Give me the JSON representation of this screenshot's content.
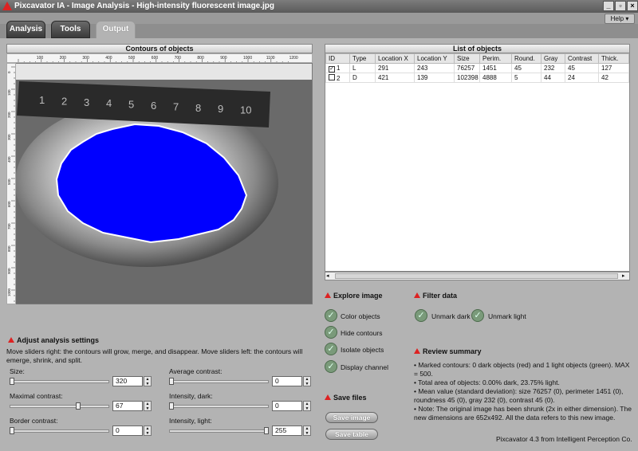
{
  "window": {
    "title": "Pixcavator IA - Image Analysis - High-intensity fluorescent image.jpg"
  },
  "menu": {
    "help_label": "Help ▾"
  },
  "tabs": [
    {
      "label": "Analysis"
    },
    {
      "label": "Tools"
    },
    {
      "label": "Output"
    }
  ],
  "left_panel": {
    "title": "Contours of objects"
  },
  "ruler": {
    "x_ticks": [
      "100",
      "200",
      "300",
      "400",
      "500",
      "600",
      "700",
      "800",
      "900",
      "1000",
      "1100",
      "1200"
    ],
    "y_ticks": [
      "0",
      "100",
      "200",
      "300",
      "400",
      "500",
      "600",
      "700",
      "800",
      "900",
      "1000"
    ]
  },
  "image": {
    "ruler_digits": [
      "1",
      "2",
      "3",
      "4",
      "5",
      "6",
      "7",
      "8",
      "9",
      "10"
    ],
    "blob_color": "#0000ff"
  },
  "list": {
    "title": "List of objects",
    "columns": [
      "ID",
      "Type",
      "Location X",
      "Location Y",
      "Size",
      "Perim.",
      "Round.",
      "Gray",
      "Contrast",
      "Thick."
    ],
    "rows": [
      {
        "checked": true,
        "cells": [
          "1",
          "L",
          "291",
          "243",
          "76257",
          "1451",
          "45",
          "232",
          "45",
          "127"
        ]
      },
      {
        "checked": false,
        "cells": [
          "2",
          "D",
          "421",
          "139",
          "102398",
          "4888",
          "5",
          "44",
          "24",
          "42"
        ]
      }
    ]
  },
  "adjust": {
    "title": "Adjust analysis settings",
    "description": "Move sliders right: the contours will grow, merge, and disappear. Move sliders left: the contours will emerge, shrink, and split.",
    "sliders": [
      {
        "label": "Size:",
        "value": "320",
        "fraction": 0.0
      },
      {
        "label": "Maximal contrast:",
        "value": "67",
        "fraction": 0.7
      },
      {
        "label": "Border contrast:",
        "value": "0",
        "fraction": 0.0
      },
      {
        "label": "Average contrast:",
        "value": "0",
        "fraction": 0.0
      },
      {
        "label": "Intensity, dark:",
        "value": "0",
        "fraction": 0.0
      },
      {
        "label": "Intensity, light:",
        "value": "255",
        "fraction": 1.0
      }
    ]
  },
  "explore": {
    "title": "Explore image",
    "options": [
      {
        "label": "Color objects"
      },
      {
        "label": "Hide contours"
      },
      {
        "label": "Isolate objects"
      },
      {
        "label": "Display channel"
      }
    ]
  },
  "filter": {
    "title": "Filter data",
    "options": [
      {
        "label": "Unmark dark"
      },
      {
        "label": "Unmark light"
      }
    ]
  },
  "save": {
    "title": "Save files",
    "buttons": [
      {
        "label": "Save image"
      },
      {
        "label": "Save table"
      }
    ]
  },
  "review": {
    "title": "Review summary",
    "lines": [
      "• Marked contours: 0 dark objects (red) and 1 light objects (green). MAX = 500.",
      "• Total area of objects: 0.00% dark, 23.75% light.",
      "• Mean value (standard deviation): size 76257 (0), perimeter 1451 (0), roundness 45 (0), gray 232 (0), contrast 45 (0).",
      "• Note: The original image has been shrunk (2x in either dimension). The new dimensions are 652x492. All the data refers to this new image."
    ]
  },
  "footer": {
    "credit": "Pixcavator 4.3 from Intelligent Perception Co."
  }
}
